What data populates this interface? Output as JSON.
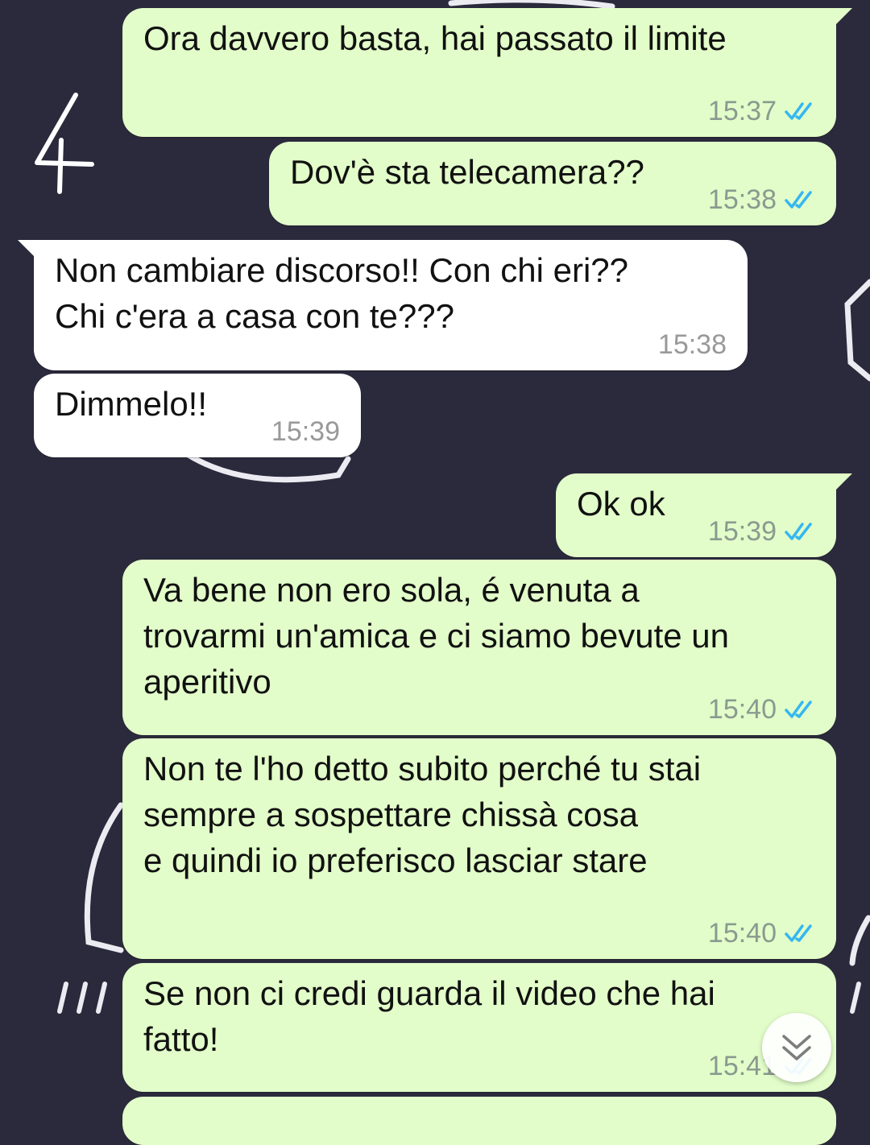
{
  "colors": {
    "background": "#2b2a3c",
    "outgoing_bubble": "#e2fdc9",
    "incoming_bubble": "#ffffff",
    "read_ticks": "#34b7f1",
    "timestamp": "#8a9a90"
  },
  "annotation": {
    "number": "4"
  },
  "messages": [
    {
      "direction": "outgoing",
      "text": "Ora davvero basta, hai passato il limite",
      "time": "15:37",
      "status": "read"
    },
    {
      "direction": "outgoing",
      "text": "Dov'è sta telecamera??",
      "time": "15:38",
      "status": "read"
    },
    {
      "direction": "incoming",
      "text": "Non cambiare discorso!! Con chi eri??\nChi c'era a casa con te???",
      "time": "15:38"
    },
    {
      "direction": "incoming",
      "text": "Dimmelo!!",
      "time": "15:39"
    },
    {
      "direction": "outgoing",
      "text": "Ok ok",
      "time": "15:39",
      "status": "read"
    },
    {
      "direction": "outgoing",
      "text": "Va bene non ero sola, é venuta a\ntrovarmi un'amica e ci siamo bevute un\naperitivo",
      "time": "15:40",
      "status": "read"
    },
    {
      "direction": "outgoing",
      "text": "Non te l'ho detto subito perché tu stai\nsempre a sospettare chissà cosa\ne quindi io preferisco lasciar stare",
      "time": "15:40",
      "status": "read"
    },
    {
      "direction": "outgoing",
      "text": "Se non ci credi guarda il video che hai\nfatto!",
      "time": "15:41",
      "status": "read"
    }
  ],
  "scroll_button": {
    "icon": "double-chevron-down-icon"
  }
}
